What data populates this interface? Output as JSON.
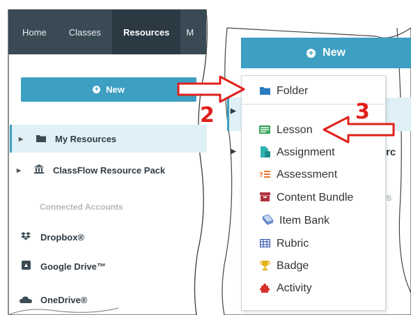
{
  "left": {
    "nav": {
      "tabs": [
        "Home",
        "Classes",
        "Resources",
        "M"
      ],
      "active": "Resources"
    },
    "new_button": "New",
    "tree": [
      {
        "label": "My Resources",
        "icon": "folder-icon",
        "selected": true
      },
      {
        "label": "ClassFlow Resource Pack",
        "icon": "institution-icon",
        "selected": false
      }
    ],
    "connected_title": "Connected Accounts",
    "accounts": [
      {
        "label": "Dropbox®",
        "icon": "dropbox-icon"
      },
      {
        "label": "Google Drive™",
        "icon": "google-drive-icon"
      },
      {
        "label": "OneDrive®",
        "icon": "onedrive-icon"
      }
    ]
  },
  "right": {
    "new_button": "New",
    "menu": [
      {
        "label": "Folder",
        "icon": "folder-icon",
        "color": "#2a7bbf"
      },
      {
        "label": "Lesson",
        "icon": "lesson-icon",
        "color": "#3aa55b"
      },
      {
        "label": "Assignment",
        "icon": "assignment-icon",
        "color": "#2fb3b1"
      },
      {
        "label": "Assessment",
        "icon": "assessment-icon",
        "color": "#e8772e"
      },
      {
        "label": "Content Bundle",
        "icon": "content-bundle-icon",
        "color": "#b0333f"
      },
      {
        "label": "Item Bank",
        "icon": "item-bank-icon",
        "color": "#5b7fc7"
      },
      {
        "label": "Rubric",
        "icon": "rubric-icon",
        "color": "#3b5db5"
      },
      {
        "label": "Badge",
        "icon": "badge-icon",
        "color": "#e2b21a"
      },
      {
        "label": "Activity",
        "icon": "activity-icon",
        "color": "#d6302c"
      }
    ],
    "peek": {
      "assignment_suffix": "rc",
      "bundle_suffix": "s"
    }
  },
  "callouts": {
    "step2": "2",
    "step3": "3"
  },
  "colors": {
    "accent": "#3d9fc2",
    "nav_bg": "#3a4a55",
    "arrow": "#e0201b"
  }
}
